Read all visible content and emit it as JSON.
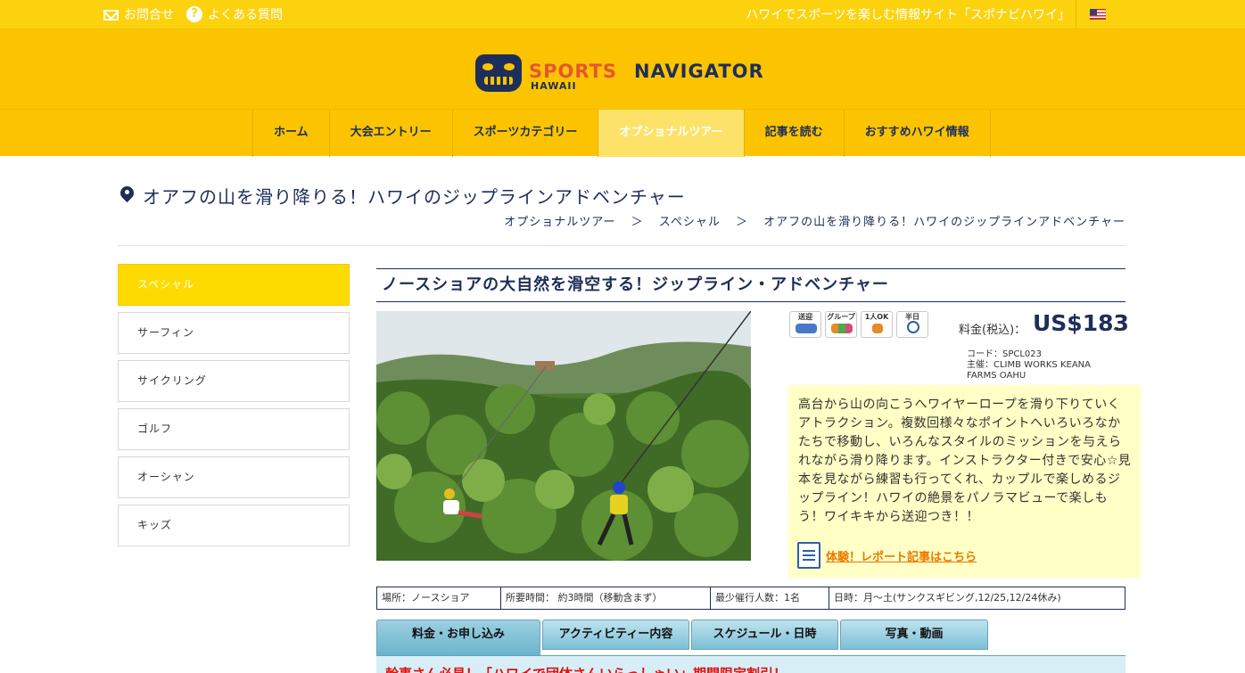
{
  "topbar": {
    "contact": "お問合せ",
    "faq": "よくある質問",
    "site_desc": "ハワイでスポーツを楽しむ情報サイト「スポナビハワイ」"
  },
  "logo": {
    "word1": "SPORTS",
    "word2": "NAVIGATOR",
    "word3": "HAWAII"
  },
  "nav": {
    "items": [
      "ホーム",
      "大会エントリー",
      "スポーツカテゴリー",
      "オプショナルツアー",
      "記事を読む",
      "おすすめハワイ情報"
    ],
    "active_index": 3
  },
  "page": {
    "title": "オアフの山を滑り降りる！ハワイのジップラインアドベンチャー",
    "breadcrumb": [
      "オプショナルツアー",
      "スペシャル",
      "オアフの山を滑り降りる！ハワイのジップラインアドベンチャー"
    ],
    "breadcrumb_sep": "＞"
  },
  "sidebar": {
    "items": [
      "スペシャル",
      "サーフィン",
      "サイクリング",
      "ゴルフ",
      "オーシャン",
      "キッズ"
    ],
    "active_index": 0
  },
  "tour": {
    "heading": "ノースショアの大自然を滑空する！ジップライン・アドベンチャー",
    "feature_icons": [
      {
        "label": "送迎",
        "icon": "car-icon"
      },
      {
        "label": "グループ",
        "icon": "group-icon"
      },
      {
        "label": "1人OK",
        "icon": "single-person-icon"
      },
      {
        "label": "半日",
        "icon": "clock-icon"
      }
    ],
    "price_label": "料金(税込)：",
    "price": "US$183",
    "price_suffix": "〜",
    "code": "コード：SPCL023",
    "organizer": "主催：CLIMB WORKS KEANA FARMS OAHU",
    "description": "高台から山の向こうへワイヤーロープを滑り下りていくアトラクション。複数回様々なポイントへいろいろなかたちで移動し、いろんなスタイルのミッションを与えられながら滑り降ります。インストラクター付きで安心☆見本を見ながら練習も行ってくれ、カップルで楽しめるジップライン！ハワイの絶景をパノラマビューで楽しもう！ワイキキから送迎つき！！",
    "report_link": "体験！レポート記事はこちら",
    "info": [
      "場所：ノースショア",
      "所要時間： 約3時間（移動含まず）",
      "最少催行人数：1名",
      "日時：月〜土(サンクスギビング,12/25,12/24休み)"
    ],
    "tabs": [
      "料金・お申し込み",
      "アクティビティー内容",
      "スケジュール・日時",
      "写真・動画"
    ],
    "active_tab": 0,
    "promo": "幹事さん必見！「ハワイで団体さんいらっしゃい」期間限定割引！"
  },
  "colors": {
    "brand_yellow": "#fcc400",
    "navy": "#1e2e5a",
    "active_yellow": "#fedb00",
    "desc_bg": "#ffffc6",
    "promo_red": "#e01010"
  }
}
